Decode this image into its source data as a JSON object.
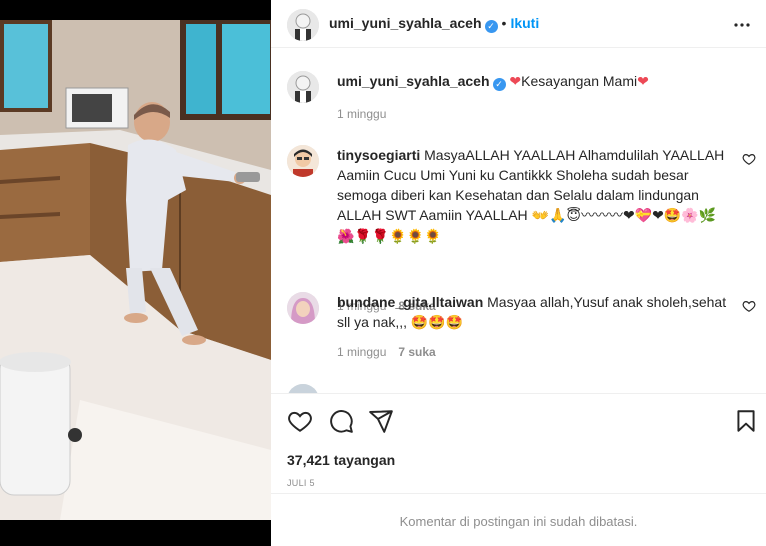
{
  "post": {
    "author": "umi_yuni_syahla_aceh",
    "follow_label": "Ikuti",
    "more_icon": "more-horizontal-icon"
  },
  "caption": {
    "author": "umi_yuni_syahla_aceh",
    "text": "Kesayangan Mami",
    "time": "1 minggu"
  },
  "comments": [
    {
      "author": "tinysoegiarti",
      "text": "MasyaALLAH YAALLAH Alhamdulilah YAALLAH Aamiin Cucu Umi Yuni ku Cantikkk Sholeha sudah besar semoga diberi kan Kesehatan dan Selalu dalam lindungan ALLAH SWT Aamiin YAALLAH",
      "emoji": "👐🙏😇〰〰〰❤💝❤🤩🌸🌿 🌺🌹🌹🌻🌻🌻",
      "time": "1 minggu",
      "likes": "8 suka"
    },
    {
      "author": "bundane_gita.lltaiwan",
      "text": "Masyaa allah,Yusuf anak sholeh,sehat sll ya nak,,,",
      "emoji": "🤩🤩🤩",
      "time": "1 minggu",
      "likes": "7 suka"
    }
  ],
  "actions": {
    "views": "37,421 tayangan",
    "date": "JULI 5"
  },
  "footer": {
    "restricted_text": "Komentar di postingan ini sudah dibatasi."
  },
  "colors": {
    "accent": "#0095f6",
    "verified": "#3897f0",
    "muted": "#8e8e8e",
    "heart_red": "#ed4956"
  }
}
